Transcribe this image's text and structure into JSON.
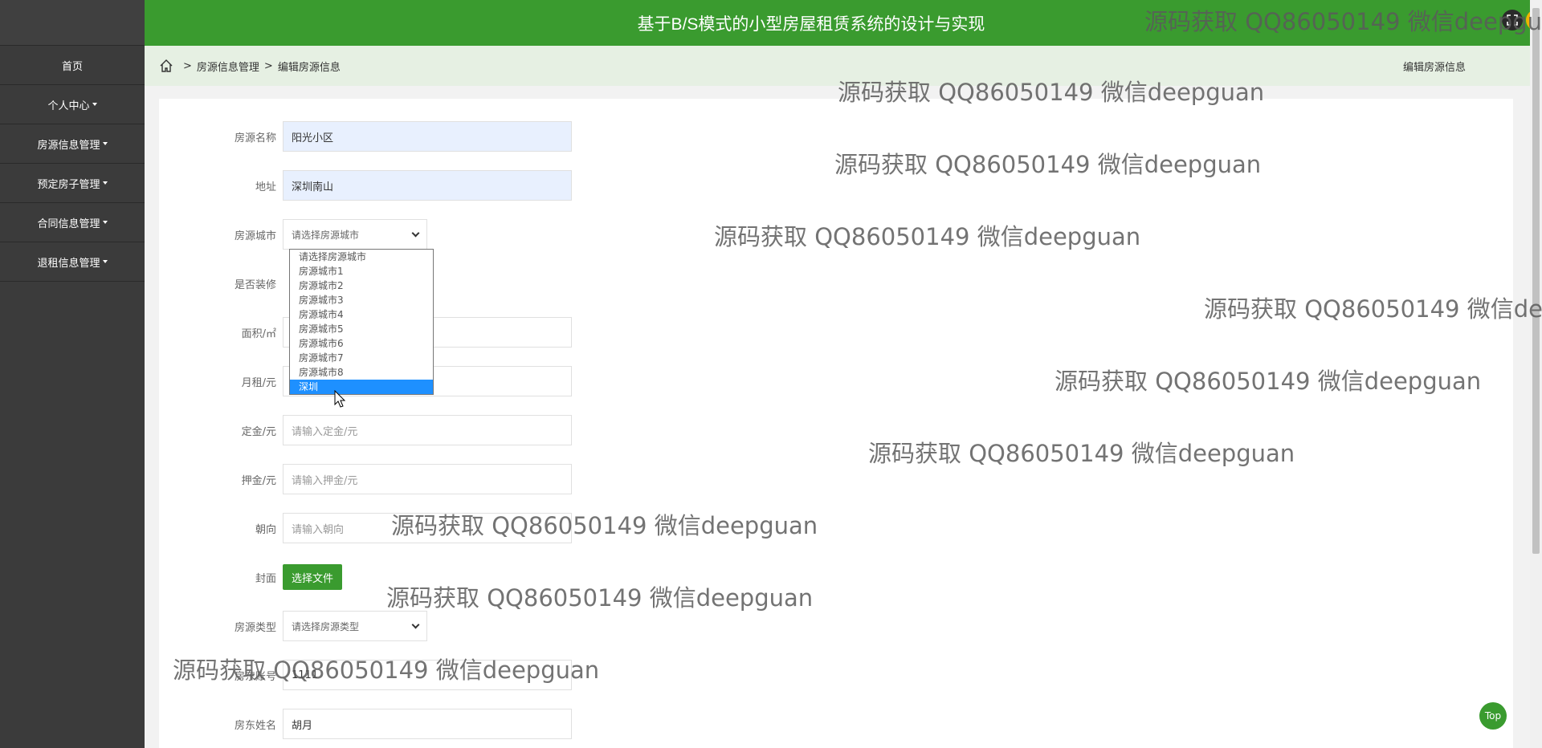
{
  "header": {
    "title": "基于B/S模式的小型房屋租赁系统的设计与实现"
  },
  "sidebar": {
    "items": [
      {
        "label": "首页",
        "has_caret": false
      },
      {
        "label": "个人中心",
        "has_caret": true
      },
      {
        "label": "房源信息管理",
        "has_caret": true
      },
      {
        "label": "预定房子管理",
        "has_caret": true
      },
      {
        "label": "合同信息管理",
        "has_caret": true
      },
      {
        "label": "退租信息管理",
        "has_caret": true
      }
    ]
  },
  "breadcrumb": {
    "sep": ">",
    "level1": "房源信息管理",
    "level2": "编辑房源信息",
    "right": "编辑房源信息"
  },
  "form": {
    "name": {
      "label": "房源名称",
      "value": "阳光小区"
    },
    "address": {
      "label": "地址",
      "value": "深圳南山"
    },
    "city": {
      "label": "房源城市",
      "selected": "请选择房源城市"
    },
    "decorated": {
      "label": "是否装修"
    },
    "area": {
      "label": "面积/㎡"
    },
    "rent": {
      "label": "月租/元"
    },
    "deposit": {
      "label": "定金/元",
      "placeholder": "请输入定金/元"
    },
    "guarantee": {
      "label": "押金/元",
      "placeholder": "请输入押金/元"
    },
    "orientation": {
      "label": "朝向",
      "placeholder": "请输入朝向"
    },
    "cover": {
      "label": "封面",
      "button": "选择文件"
    },
    "type": {
      "label": "房源类型",
      "selected": "请选择房源类型"
    },
    "landlord_account": {
      "label": "房东账号",
      "value": "1111"
    },
    "landlord_name": {
      "label": "房东姓名",
      "value": "胡月"
    }
  },
  "city_dropdown": {
    "options": [
      "请选择房源城市",
      "房源城市1",
      "房源城市2",
      "房源城市3",
      "房源城市4",
      "房源城市5",
      "房源城市6",
      "房源城市7",
      "房源城市8",
      "深圳"
    ],
    "highlighted": "深圳"
  },
  "top_button": "Top",
  "watermark": "源码获取 QQ86050149 微信deepguan",
  "colors": {
    "accent": "#3a9b2f",
    "sidebar": "#3b3b3b",
    "selected_option": "#1e90ff"
  }
}
